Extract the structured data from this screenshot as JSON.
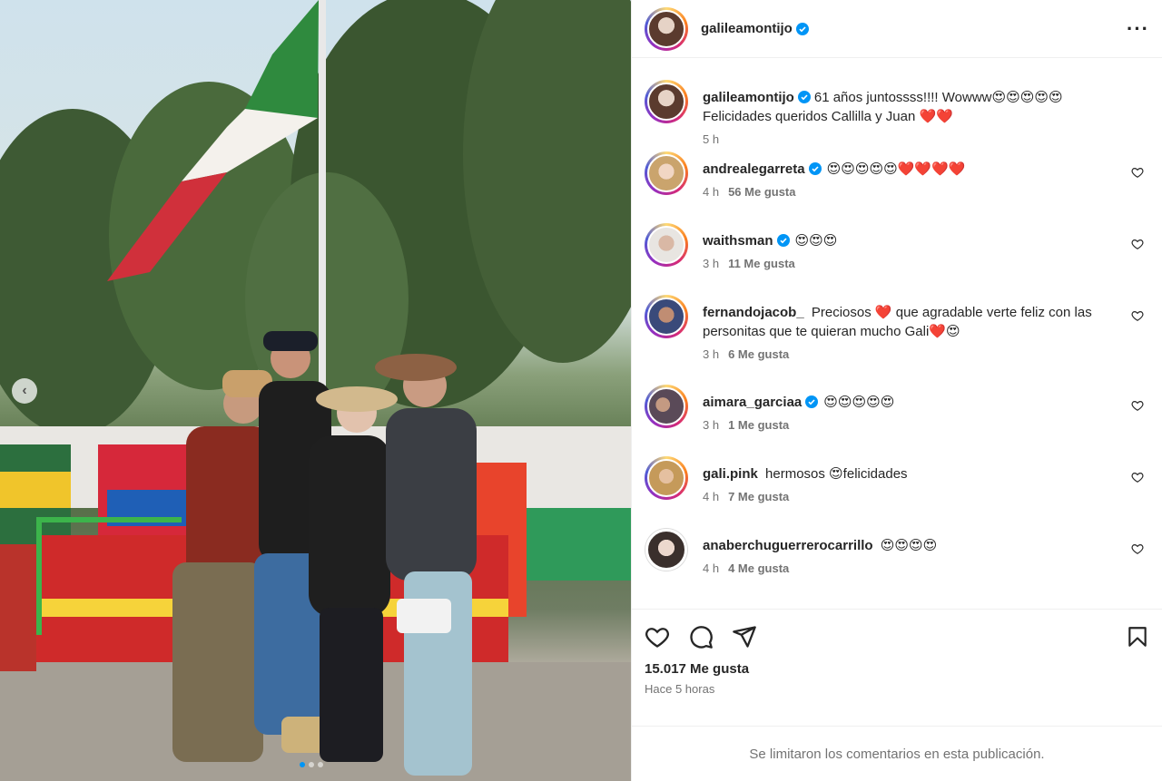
{
  "post": {
    "author": "galileamontijo",
    "caption_line1": "61 años juntossss!!!! Wowww😍😍😍😍😍",
    "caption_line2": "Felicidades queridos Callilla y Juan ❤️❤️",
    "caption_time": "5 h"
  },
  "comments": [
    {
      "user": "andrealegarreta",
      "verified": true,
      "text": "😍😍😍😍😍❤️❤️❤️❤️",
      "time": "4 h",
      "likes": "56 Me gusta"
    },
    {
      "user": "waithsman",
      "verified": true,
      "text": "😍😍😍",
      "time": "3 h",
      "likes": "11 Me gusta"
    },
    {
      "user": "fernandojacob_",
      "verified": false,
      "text": "Preciosos ❤️ que agradable verte feliz con las personitas que te quieran mucho Gali❤️😍",
      "time": "3 h",
      "likes": "6 Me gusta"
    },
    {
      "user": "aimara_garciaa",
      "verified": true,
      "text": "😍😍😍😍😍",
      "time": "3 h",
      "likes": "1 Me gusta"
    },
    {
      "user": "gali.pink",
      "verified": false,
      "text": "hermosos 😍felicidades",
      "time": "4 h",
      "likes": "7 Me gusta"
    },
    {
      "user": "anaberchuguerrerocarrillo",
      "verified": false,
      "text": "😍😍😍😍",
      "time": "4 h",
      "likes": "4 Me gusta"
    }
  ],
  "footer": {
    "likes_total": "15.017 Me gusta",
    "posted": "Hace 5 horas",
    "comments_limited": "Se limitaron los comentarios en esta publicación."
  },
  "colors": {
    "verified": "#0095f6",
    "like_red": "#ed4956"
  }
}
